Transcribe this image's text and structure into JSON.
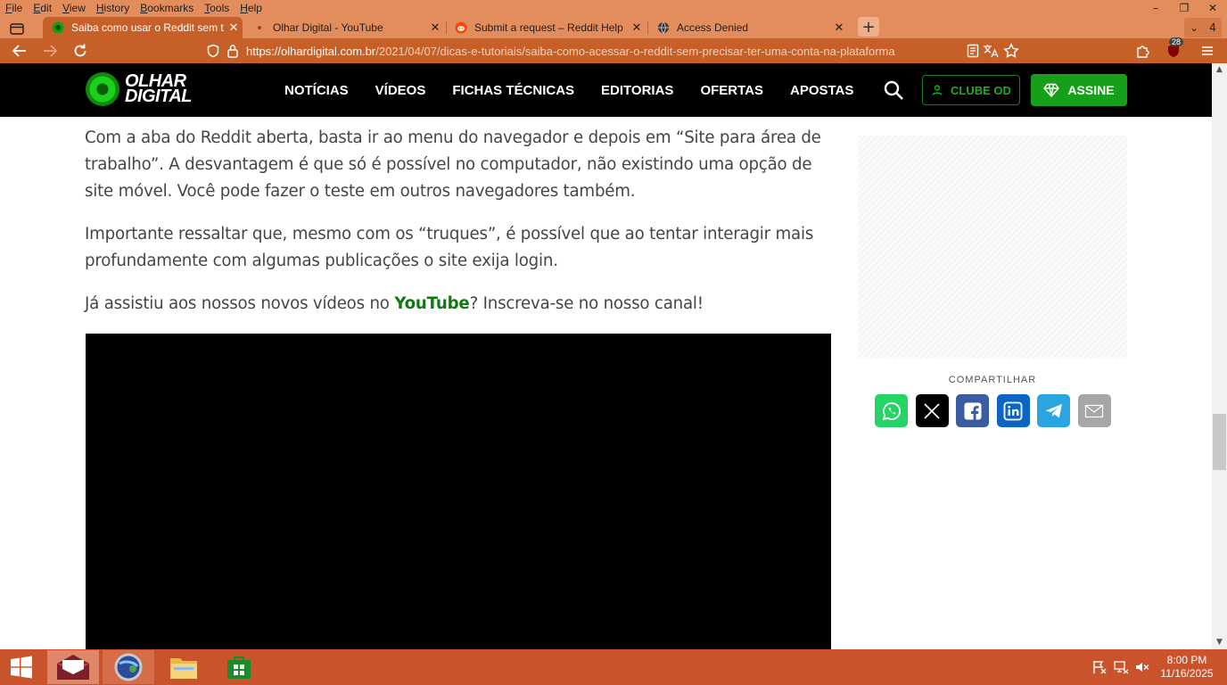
{
  "browser": {
    "menu": [
      "File",
      "Edit",
      "View",
      "History",
      "Bookmarks",
      "Tools",
      "Help"
    ],
    "window_controls": [
      "–",
      "❐",
      "✕"
    ],
    "tabs": [
      {
        "label": "Saiba como usar o Reddit sem t",
        "favicon": "olhar-digital-icon",
        "active": true
      },
      {
        "label": "Olhar Digital - YouTube",
        "favicon": "dot-icon",
        "active": false
      },
      {
        "label": "Submit a request – Reddit Help",
        "favicon": "reddit-icon",
        "active": false
      },
      {
        "label": "Access Denied",
        "favicon": "globe-icon",
        "active": false
      }
    ],
    "tab_close": "✕",
    "new_tab": "+",
    "tab_count": "4",
    "tab_count_chevron": "⌄",
    "url_host": "https://olhardigital.com.br",
    "url_path": "/2021/04/07/dicas-e-tutoriais/saiba-como-acessar-o-reddit-sem-precisar-ter-uma-conta-na-plataforma",
    "extension_badge": "28"
  },
  "site": {
    "logo_line1": "OLHAR",
    "logo_line2": "DIGITAL",
    "nav": [
      "NOTÍCIAS",
      "VÍDEOS",
      "FICHAS TÉCNICAS",
      "EDITORIAS",
      "OFERTAS",
      "APOSTAS"
    ],
    "clube_label": "CLUBE OD",
    "assine_label": "ASSINE"
  },
  "article": {
    "p1": "Com a aba do Reddit aberta, basta ir ao menu do navegador e depois em “Site para área de trabalho”. A desvantagem é que só é possível no computador, não existindo uma opção de site móvel.  Você pode fazer o teste em outros navegadores também.",
    "p2": "Importante ressaltar que, mesmo com os “truques”, é possível que ao tentar interagir mais profundamente com algumas publicações o site exija login.",
    "p3_before": "Já assistiu aos nossos novos vídeos no ",
    "p3_link": "YouTube",
    "p3_after": "? Inscreva-se no nosso canal!"
  },
  "sidebar": {
    "share_label": "COMPARTILHAR",
    "share_buttons": [
      {
        "name": "whatsapp-icon",
        "color": "#25d366"
      },
      {
        "name": "x-icon",
        "color": "#000000"
      },
      {
        "name": "facebook-icon",
        "color": "#3b5ba3"
      },
      {
        "name": "linkedin-icon",
        "color": "#0a66c2"
      },
      {
        "name": "telegram-icon",
        "color": "#2aa5e0"
      },
      {
        "name": "email-icon",
        "color": "#a6a6a6"
      }
    ]
  },
  "taskbar": {
    "time": "8:00 PM",
    "date": "11/16/2025"
  },
  "colors": {
    "titlebar": "#e38d5c",
    "active_tab": "#c75f28",
    "site_header": "#000000",
    "link_green": "#0f7a12",
    "assine_green": "#16a01a",
    "taskbar": "#c9532a"
  }
}
